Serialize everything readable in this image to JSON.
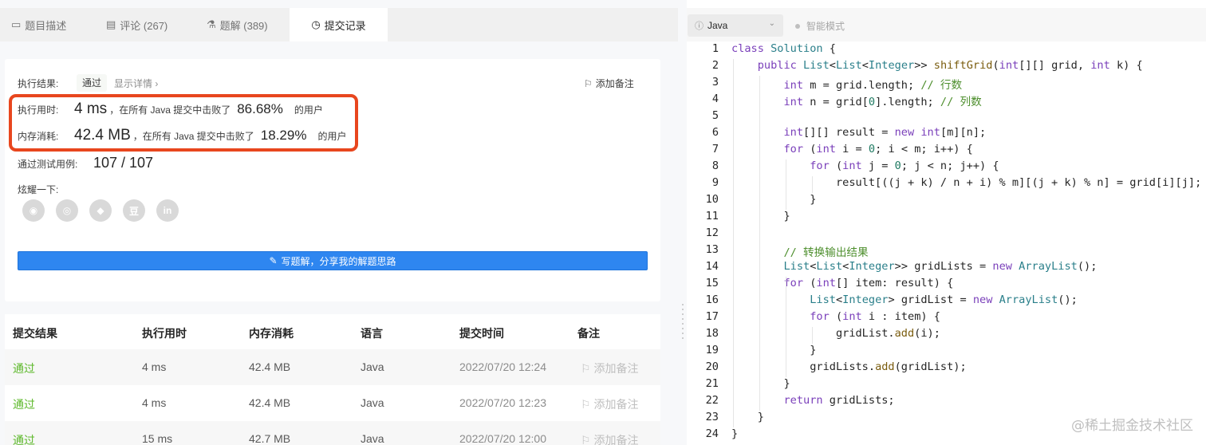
{
  "tabs": [
    {
      "icon": "description-icon",
      "label": "题目描述"
    },
    {
      "icon": "comment-icon",
      "label": "评论 (267)"
    },
    {
      "icon": "flask-icon",
      "label": "题解 (389)"
    },
    {
      "icon": "clock-icon",
      "label": "提交记录"
    }
  ],
  "result": {
    "label": "执行结果:",
    "status": "通过",
    "detail_link": "显示详情 ›",
    "add_note": "添加备注",
    "runtime_key": "执行用时:",
    "runtime_value": "4 ms",
    "runtime_mid": "，在所有 Java 提交中击败了",
    "runtime_pct": "86.68%",
    "runtime_tail": "的用户",
    "memory_key": "内存消耗:",
    "memory_value": "42.4 MB",
    "memory_mid": "，在所有 Java 提交中击败了",
    "memory_pct": "18.29%",
    "memory_tail": "的用户",
    "cases_key": "通过测试用例:",
    "cases_value": "107 / 107",
    "share_label": "炫耀一下:",
    "share_icons": [
      "wechat-icon",
      "weibo-icon",
      "qq-icon",
      "douban-icon",
      "linkedin-icon"
    ],
    "share_glyphs": [
      "◉",
      "◎",
      "◆",
      "豆",
      "in"
    ],
    "solution_button": "写题解，分享我的解题思路"
  },
  "table": {
    "headers": [
      "提交结果",
      "执行用时",
      "内存消耗",
      "语言",
      "提交时间",
      "备注"
    ],
    "rows": [
      {
        "status": "通过",
        "time": "4 ms",
        "memory": "42.4 MB",
        "lang": "Java",
        "submitted": "2022/07/20 12:24",
        "note": "添加备注"
      },
      {
        "status": "通过",
        "time": "4 ms",
        "memory": "42.4 MB",
        "lang": "Java",
        "submitted": "2022/07/20 12:23",
        "note": "添加备注"
      },
      {
        "status": "通过",
        "time": "15 ms",
        "memory": "42.7 MB",
        "lang": "Java",
        "submitted": "2022/07/20 12:00",
        "note": "添加备注"
      }
    ]
  },
  "editor": {
    "language": "Java",
    "smart_mode": "智能模式",
    "watermark": "@稀土掘金技术社区"
  },
  "code_lines": [
    "class Solution {",
    "    public List<List<Integer>> shiftGrid(int[][] grid, int k) {",
    "        int m = grid.length; // 行数",
    "        int n = grid[0].length; // 列数",
    "",
    "        int[][] result = new int[m][n];",
    "        for (int i = 0; i < m; i++) {",
    "            for (int j = 0; j < n; j++) {",
    "                result[((j + k) / n + i) % m][(j + k) % n] = grid[i][j];",
    "            }",
    "        }",
    "",
    "        // 转换输出结果",
    "        List<List<Integer>> gridLists = new ArrayList();",
    "        for (int[] item: result) {",
    "            List<Integer> gridList = new ArrayList();",
    "            for (int i : item) {",
    "                gridList.add(i);",
    "            }",
    "            gridLists.add(gridList);",
    "        }",
    "        return gridLists;",
    "    }",
    "}"
  ]
}
